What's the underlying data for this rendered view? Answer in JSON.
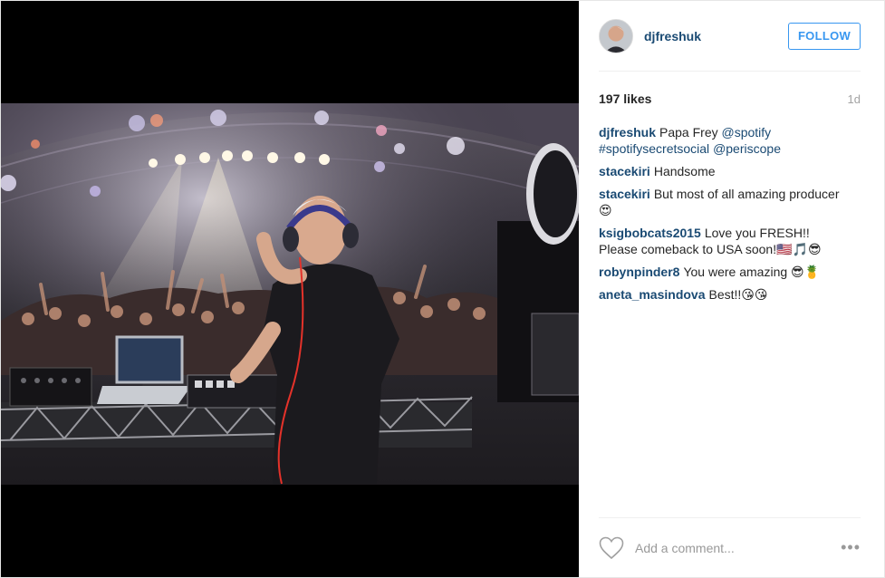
{
  "post": {
    "username": "djfreshuk",
    "follow_label": "FOLLOW",
    "likes": "197 likes",
    "time_ago": "1d",
    "accent_color": "#3897f0",
    "link_color": "#1a4a73"
  },
  "comments": [
    {
      "user": "djfreshuk",
      "parts": [
        "Papa Frey ",
        "@spotify",
        " ",
        "#spotifysecretsocial",
        " ",
        "@periscope"
      ]
    },
    {
      "user": "stacekiri",
      "text": "Handsome"
    },
    {
      "user": "stacekiri",
      "text": "But most of all amazing producer 😍"
    },
    {
      "user": "ksigbobcats2015",
      "text": "Love you FRESH!! Please comeback to USA soon!🇺🇸🎵😎"
    },
    {
      "user": "robynpinder8",
      "text": "You were amazing 😎🍍"
    },
    {
      "user": "aneta_masindova",
      "text": "Best!!😘😘"
    }
  ],
  "footer": {
    "comment_placeholder": "Add a comment...",
    "more_label": "•••"
  },
  "icons": {
    "like": "heart-icon",
    "more": "more-options-icon"
  }
}
